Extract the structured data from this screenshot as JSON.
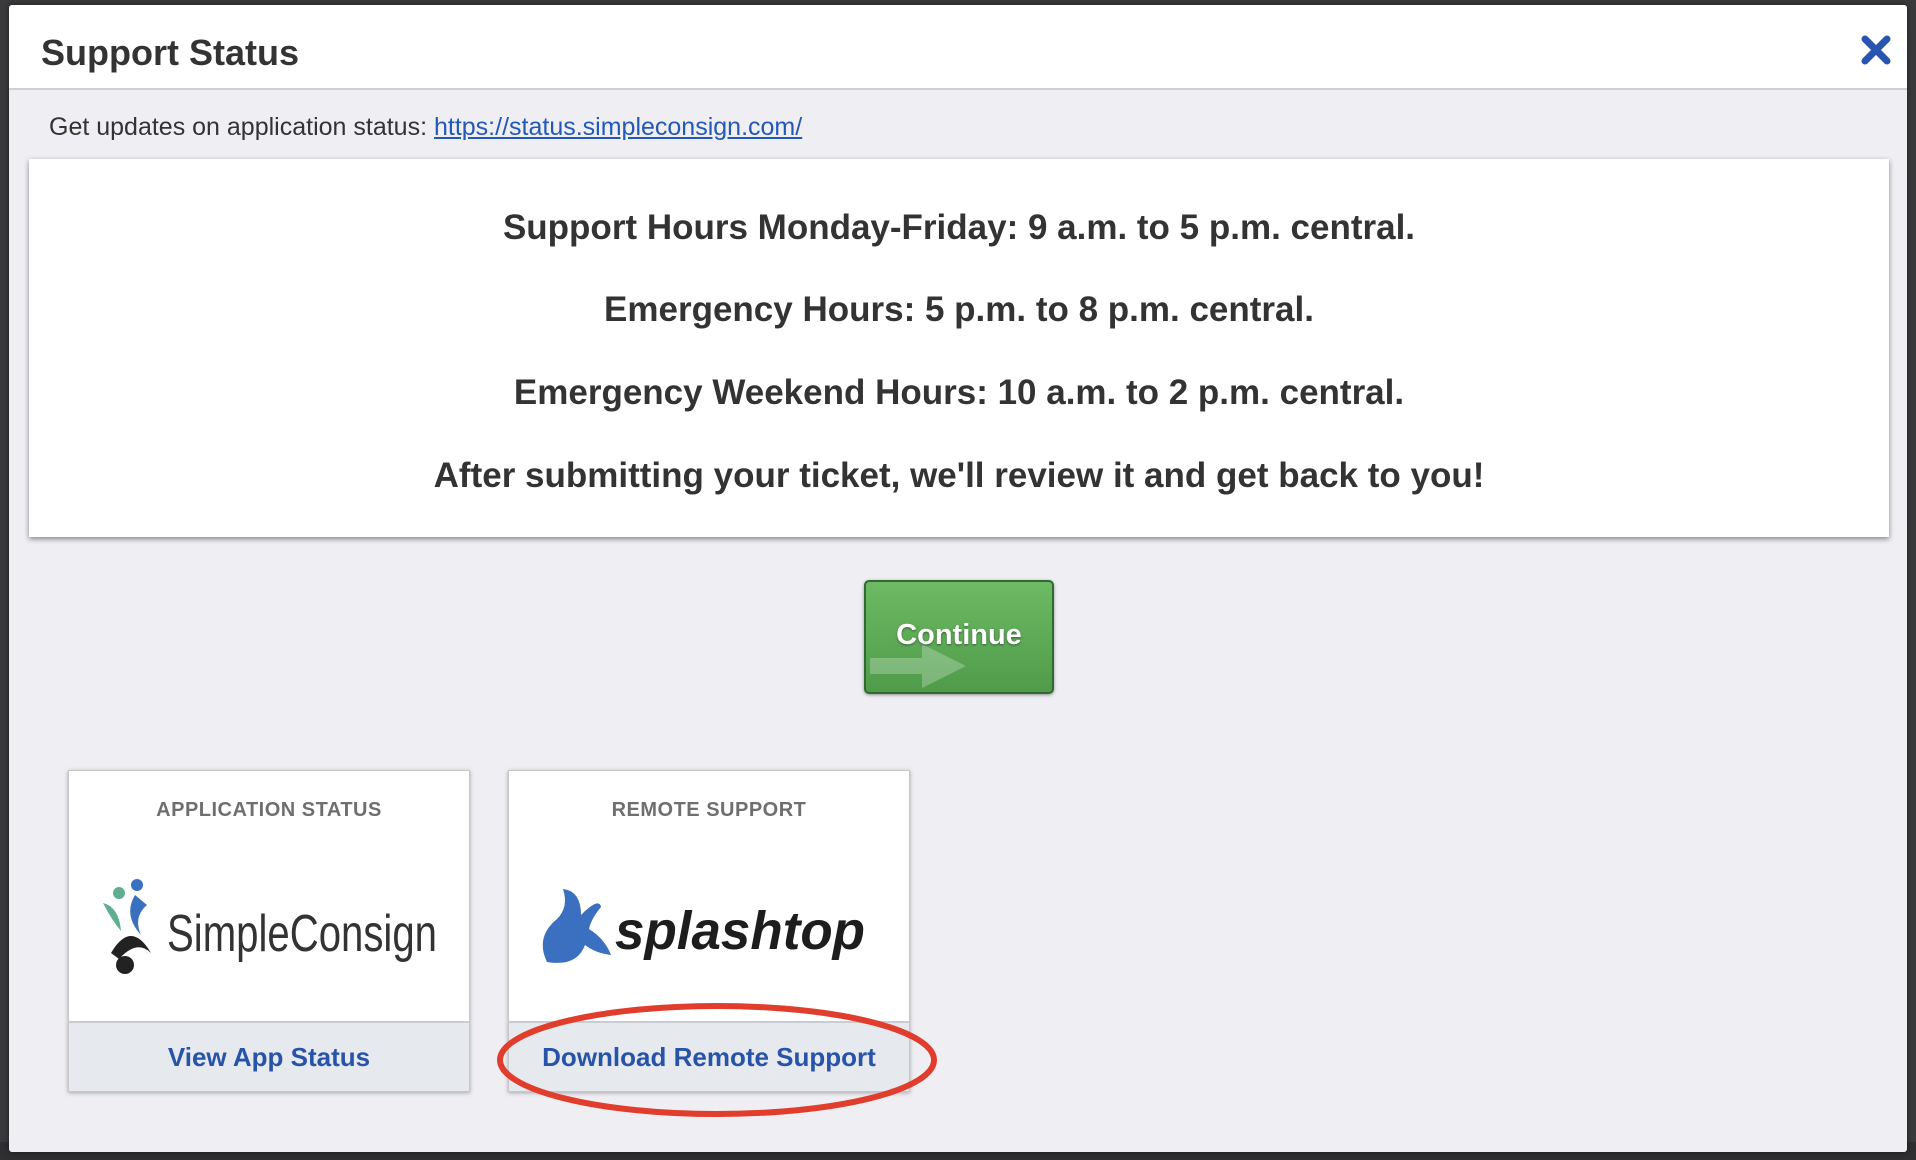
{
  "modal": {
    "title": "Support Status",
    "close_icon": "close-icon",
    "status_prefix": "Get updates on application status: ",
    "status_link": "https://status.simpleconsign.com/"
  },
  "hours": [
    "Support Hours Monday-Friday: 9 a.m. to 5 p.m. central.",
    "Emergency Hours: 5 p.m. to 8 p.m. central.",
    "Emergency Weekend Hours: 10 a.m. to 2 p.m. central.",
    "After submitting your ticket, we'll review it and get back to you!"
  ],
  "continue_button": {
    "label": "Continue"
  },
  "cards": [
    {
      "heading": "APPLICATION STATUS",
      "logo_text": "SimpleConsign",
      "action": "View App Status"
    },
    {
      "heading": "REMOTE SUPPORT",
      "logo_text": "splashtop",
      "action": "Download Remote Support"
    }
  ],
  "colors": {
    "link": "#2458b8",
    "close_icon": "#2755b0",
    "continue_green": "#5aa955",
    "annotation_red": "#e03d2c",
    "splashtop_blue": "#3b6fbf"
  }
}
